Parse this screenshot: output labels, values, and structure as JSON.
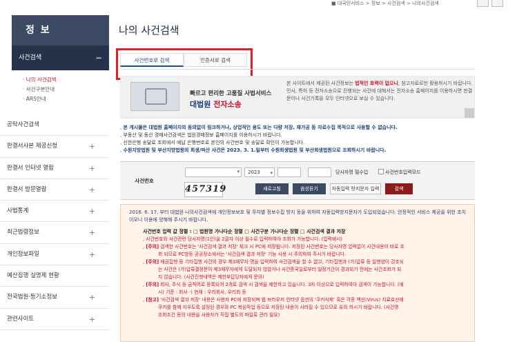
{
  "topbar": {
    "breadcrumb": "■ 대국민서비스 > 정보 > 사건검색 > 나의사건검색"
  },
  "sidebar": {
    "heading": "정 보",
    "active_category": "사건검색",
    "collapse_symbol": "−",
    "sub_items": [
      {
        "label": "· 나의 사건검색",
        "active": true
      },
      {
        "label": "· 사건구분안내",
        "active": false
      },
      {
        "label": "· ARS안내",
        "active": false
      }
    ],
    "items": [
      {
        "label": "공탁사건검색",
        "expandable": false
      },
      {
        "label": "판결서사본 제공신청",
        "expandable": true
      },
      {
        "label": "판결서 인터넷 열람",
        "expandable": true
      },
      {
        "label": "판결서 방문열람",
        "expandable": true
      },
      {
        "label": "사법통계",
        "expandable": true
      },
      {
        "label": "최근법령정보",
        "expandable": true
      },
      {
        "label": "개인정보파일",
        "expandable": true
      },
      {
        "label": "예산집행 실명제 현황",
        "expandable": false
      },
      {
        "label": "전국법원·등기소정보",
        "expandable": true
      },
      {
        "label": "관련사이트",
        "expandable": true
      }
    ],
    "plus_symbol": "+"
  },
  "main": {
    "title": "나의 사건검색",
    "tabs": [
      {
        "label": "사건번호로 검색",
        "active": true
      },
      {
        "label": "인증서로 검색",
        "active": false
      }
    ],
    "banner": {
      "line1": "빠르고 편리한 고품질 사법서비스",
      "line2_a": "대법원 ",
      "line2_b": "전자소송",
      "desc_a": "본 사이트에서 제공된 사건정보는 ",
      "desc_red": "법적인 효력이 없으니",
      "desc_b": ", 참고자료로만 활용하시기 바랍니다.",
      "desc_c": "민사, 특허 등 전자소송으로 진행되는 사건에 대해서는 전자소송 홈페이지를 이용하시면 판결문이나 사건기록을 모두 인터넷으로 보실 수 있습니다."
    },
    "notes": [
      "본 게시물은 대법원 홈페이지의 동의없이 링크하거나, 상업적인 용도 또는 다량 저장, 재가공 등 자료수집 목적으로 사용할 수 없습니다.",
      "부동산 및 동산 경매사건검색은 법원경매정보 홈페이지를 이용하시기 바랍니다.",
      "신한은행 송달료 조회에서 예납 은행번호로 본인의 사건번호 및 송달료 확인이 가능합니다.",
      "수원지방법원 및 부산지방법원의 회생/파산 사건은 2023. 3. 1.일부터 수원회생법원 및 부산회생법원으로 조회하시기 바랍니다."
    ],
    "form": {
      "label": "사건번호",
      "year": "2023",
      "required_label": "당사자명 필수입",
      "mode_label": "사건번호입력모드",
      "captcha": "457319",
      "refresh": "새로고침",
      "voice": "음성듣기",
      "antispam": "자동입력 방지문자 입력",
      "search": "검색"
    },
    "warning": {
      "notice": "2016. 6. 17. 부터 대법원 나의사건검색에 개인정보보호 및 무차별 정보수집 방지 등을 위하여 자동입력방지문자가 도입되었습니다. 안정적인 서비스 제공을 위한 조치이오니 이용에 양해해 주시기 바랍니다.",
      "header": "사건번호 입력 값 정렬 : □ 법원명 가나다순 정렬  □ 사건구분 가나다순 정렬  □ 사건검색 결과 저장",
      "lines": [
        {
          "tag": "",
          "text": "사건번호와 사건관련 당사자명(1인)을 2글자 이상 필수로 입력하여야 조회가 가능합니다. (입력예시)"
        },
        {
          "tag": "[주의]",
          "text": " 검색한 사건번호는 '사건검색 결과 저장' 체크 시 PC에 저장됩니다. 저장된 사건번호는 당사자명 입력없이 사건내용이 바로 조"
        },
        {
          "tag": "",
          "text": "회 되므로 PC방등 공공장소에서는 '사건검색 결과 저장' 기능 사용 시 주의하여 주시기 바랍니다.",
          "sub": true
        },
        {
          "tag": "[주의]",
          "text": " 재권집행 등 기타집행 사건의 경우 제3채무자 명을 입력하여 사건검색을 할 수 없고, 기타집행과 (가)압류 등 일행성이 강조되"
        },
        {
          "tag": "",
          "text": "는 사건은 (가)압류결정문이 제3채무자에게 도달되지 않았거나 사건종국일로부터 일정기간이 경과되기 전에는 사건조회가 되",
          "sub": true
        },
        {
          "tag": "",
          "text": "지 않습니다. (사건진행내역은 제한부답당자에게 문의)",
          "sub": true
        },
        {
          "tag": "[주의]",
          "text": " 회사, 주식 등 금칙어로 등록되어 2개로 검색 시 검색을 제한하고 있습니다. 3자 이상으로 입력하여야 검색이 가능합니다. (예"
        },
        {
          "tag": "",
          "text": "시) 기준 : 회사 -) 현재 : 우리회사, 우리회 등",
          "sub": true
        },
        {
          "tag": "[참고]",
          "text": " '사건검색 결과 저장' 내용은 사용자 PC에 저장되며 웹 브라우저 인터넷 옵션의 '쿠키삭제' 혹은 각종 백신(Virus) 치료효선에"
        },
        {
          "tag": "",
          "text": "쿠키를 함께 지우도록 설정된 경우와 PC 복원작업 등으로 저장된 내용이 사라질 수 있으므로 유의 하시기 바랍니다. (사건명",
          "sub": true
        },
        {
          "tag": "",
          "text": "조회조건 등의 내용을 사용자가 직접 별도의 파일로 관리 필요)",
          "sub": true
        }
      ]
    }
  },
  "colors": {
    "sidebar_header": "#3c4963",
    "sidebar_active": "#26324a",
    "accent_red": "#c8102e",
    "highlight_box": "#e31f1f",
    "warning_bg": "#fff3ea"
  }
}
